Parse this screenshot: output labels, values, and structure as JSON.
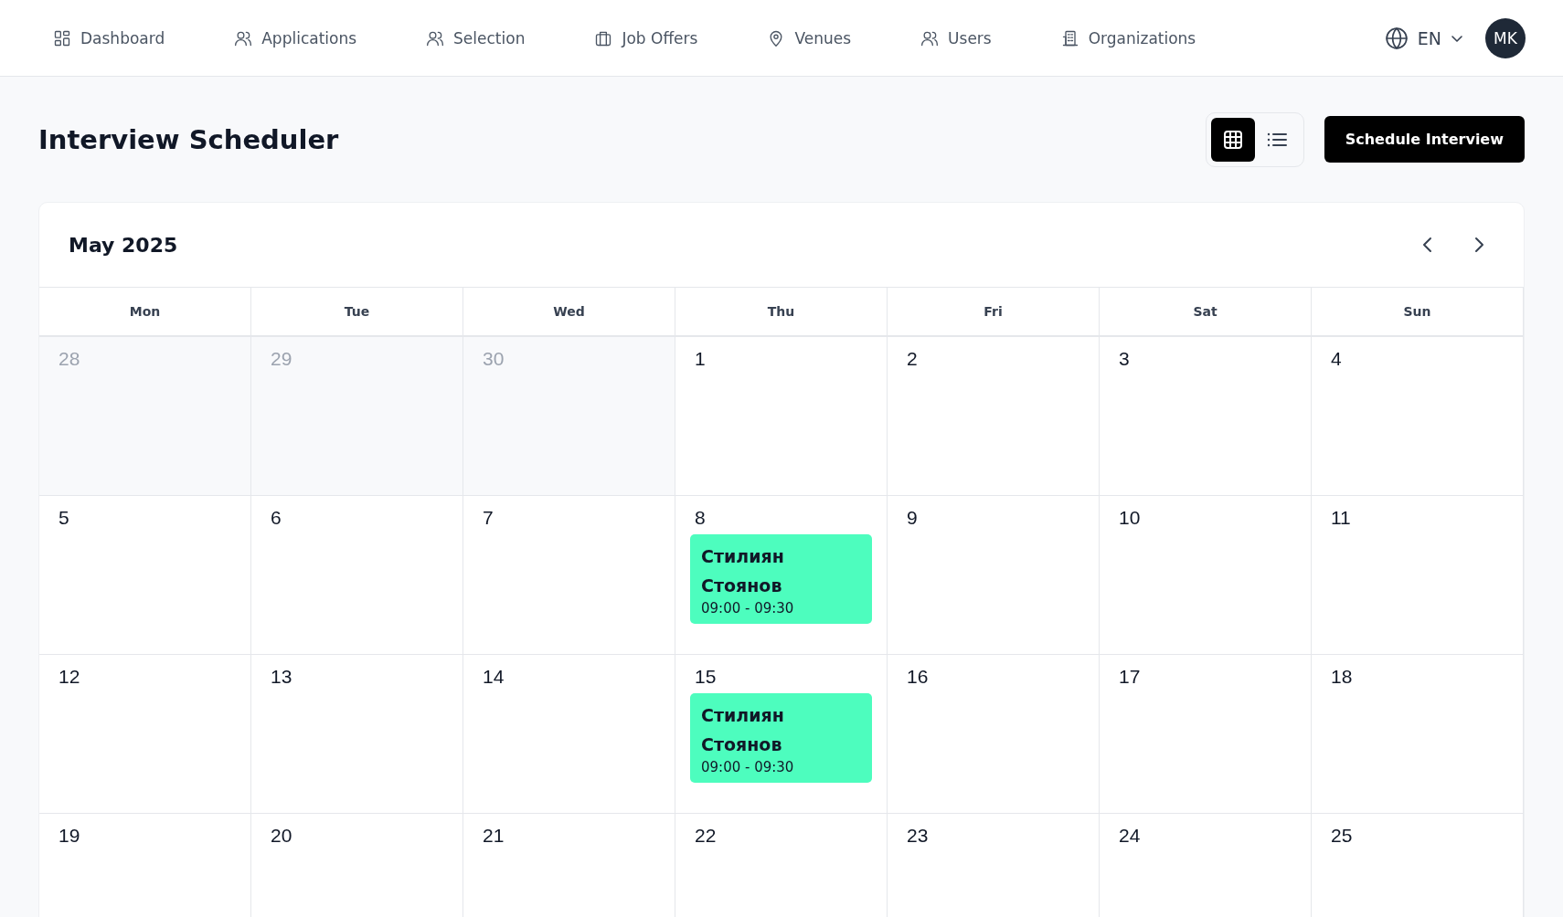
{
  "nav": {
    "items": [
      {
        "label": "Dashboard",
        "selected": false
      },
      {
        "label": "Applications",
        "selected": false
      },
      {
        "label": "Selection",
        "selected": false
      },
      {
        "label": "Job Offers",
        "selected": false
      },
      {
        "label": "Venues",
        "selected": false
      },
      {
        "label": "Users",
        "selected": false
      },
      {
        "label": "Organizations",
        "selected": false
      }
    ],
    "language": "EN",
    "avatar": "MK"
  },
  "page": {
    "title": "Interview Scheduler",
    "views": [
      {
        "kind": "grid",
        "selected": true
      },
      {
        "kind": "list",
        "selected": false
      }
    ],
    "primary_button": "Schedule Interview"
  },
  "calendar": {
    "month": "May 2025",
    "weekdays": [
      "Mon",
      "Tue",
      "Wed",
      "Thu",
      "Fri",
      "Sat",
      "Sun"
    ],
    "weeks": [
      [
        {
          "day": "28",
          "outside": true
        },
        {
          "day": "29",
          "outside": true
        },
        {
          "day": "30",
          "outside": true
        },
        {
          "day": "1",
          "outside": false
        },
        {
          "day": "2",
          "outside": false
        },
        {
          "day": "3",
          "outside": false
        },
        {
          "day": "4",
          "outside": false
        }
      ],
      [
        {
          "day": "5",
          "outside": false
        },
        {
          "day": "6",
          "outside": false
        },
        {
          "day": "7",
          "outside": false
        },
        {
          "day": "8",
          "outside": false,
          "events": [
            {
              "name": "Стилиян Стоянов",
              "time": "09:00 - 09:30",
              "color": "#4dfdbe"
            }
          ]
        },
        {
          "day": "9",
          "outside": false
        },
        {
          "day": "10",
          "outside": false
        },
        {
          "day": "11",
          "outside": false
        }
      ],
      [
        {
          "day": "12",
          "outside": false
        },
        {
          "day": "13",
          "outside": false
        },
        {
          "day": "14",
          "outside": false
        },
        {
          "day": "15",
          "outside": false,
          "events": [
            {
              "name": "Стилиян Стоянов",
              "time": "09:00 - 09:30",
              "color": "#4dfdbe"
            }
          ]
        },
        {
          "day": "16",
          "outside": false
        },
        {
          "day": "17",
          "outside": false
        },
        {
          "day": "18",
          "outside": false
        }
      ],
      [
        {
          "day": "19",
          "outside": false
        },
        {
          "day": "20",
          "outside": false
        },
        {
          "day": "21",
          "outside": false
        },
        {
          "day": "22",
          "outside": false
        },
        {
          "day": "23",
          "outside": false
        },
        {
          "day": "24",
          "outside": false
        },
        {
          "day": "25",
          "outside": false
        }
      ]
    ]
  }
}
